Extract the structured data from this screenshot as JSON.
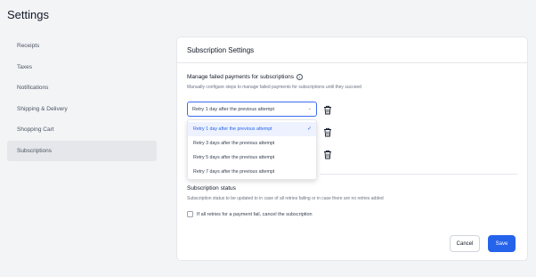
{
  "page": {
    "title": "Settings"
  },
  "sidebar": {
    "items": [
      {
        "label": "Receipts"
      },
      {
        "label": "Taxes"
      },
      {
        "label": "Notifications"
      },
      {
        "label": "Shipping & Delivery"
      },
      {
        "label": "Shopping Cart"
      },
      {
        "label": "Subscriptions"
      }
    ],
    "active_index": 5
  },
  "card": {
    "title": "Subscription Settings",
    "failed_payments": {
      "title": "Manage failed payments for subscriptions",
      "info_icon": "info-icon",
      "description": "Manually configure steps to manage failed payments for subscriptions until they succeed",
      "retry_select_value": "Retry 1 day after the previous attempt",
      "options": [
        "Retry 1 day after the previous attempt",
        "Retry 3 days after the previous attempt",
        "Retry 5 days after the previous attempt",
        "Retry 7 days after the previous attempt"
      ],
      "selected_option_index": 0
    },
    "subscription_status": {
      "title": "Subscription status",
      "description": "Subscription status to be updated to in case of all retries failing or in case there are no retries added",
      "checkbox_label": "If all retries for a payment fail, cancel the subscription",
      "checkbox_checked": false
    },
    "buttons": {
      "cancel": "Cancel",
      "save": "Save"
    }
  },
  "colors": {
    "accent": "#2563eb",
    "background": "#f3f4f6",
    "card": "#ffffff"
  }
}
